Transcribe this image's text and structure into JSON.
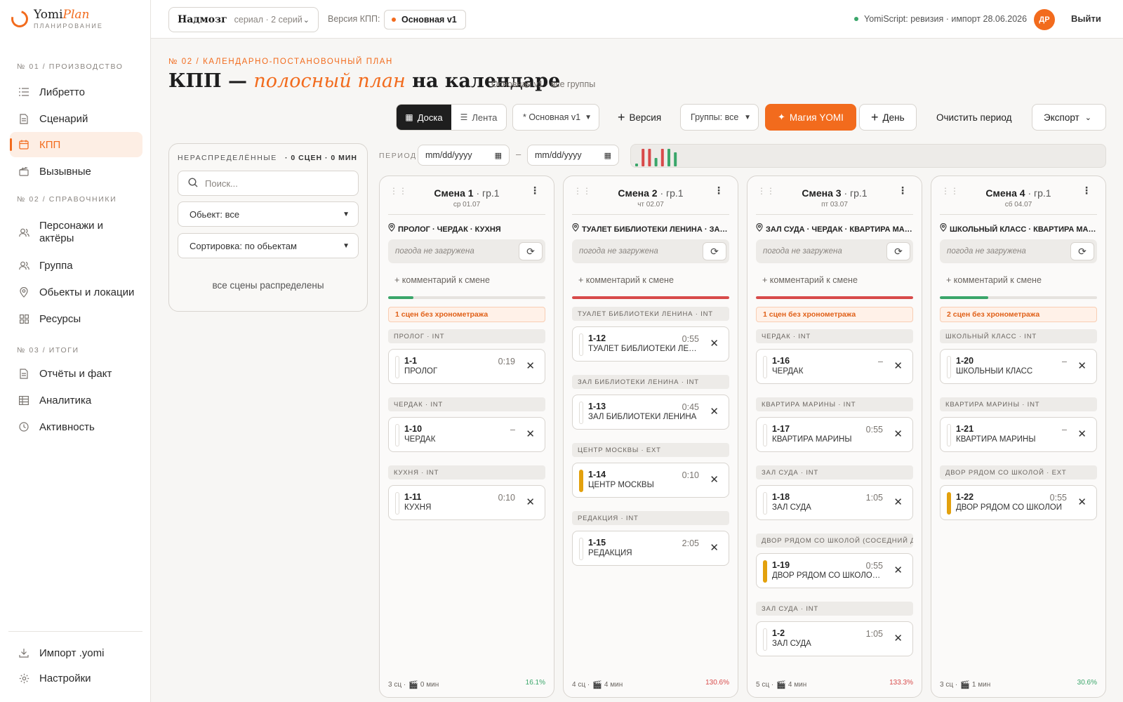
{
  "brand": {
    "name": "Yomi",
    "name_accent": "Plan",
    "sub": "ПЛАНИРОВАНИЕ",
    "accent": "#f26b1d"
  },
  "sidebar": {
    "sections": [
      {
        "title": "№ 01 / ПРОИЗВОДСТВО"
      },
      {
        "title": "№ 02 / СПРАВОЧНИКИ"
      },
      {
        "title": "№ 03 / ИТОГИ"
      }
    ],
    "items": [
      {
        "label": "Либретто",
        "icon": "list-icon"
      },
      {
        "label": "Сценарий",
        "icon": "document-icon"
      },
      {
        "label": "КПП",
        "icon": "calendar-icon",
        "active": true
      },
      {
        "label": "Вызывные",
        "icon": "clapper-icon"
      },
      {
        "label": "Персонажи и актёры",
        "icon": "people-icon"
      },
      {
        "label": "Группа",
        "icon": "group-icon"
      },
      {
        "label": "Обьекты и локации",
        "icon": "pin-icon"
      },
      {
        "label": "Ресурсы",
        "icon": "grid-icon"
      },
      {
        "label": "Отчёты и факт",
        "icon": "report-icon"
      },
      {
        "label": "Аналитика",
        "icon": "table-icon"
      },
      {
        "label": "Активность",
        "icon": "clock-icon"
      }
    ],
    "bottom": [
      {
        "label": "Импорт .yomi",
        "icon": "download-icon"
      },
      {
        "label": "Настройки",
        "icon": "gear-icon"
      }
    ]
  },
  "header": {
    "project_name": "Надмозг",
    "project_meta": "сериал · 2 серий",
    "version_label": "Версия КПП:",
    "version_value": "Основная v1",
    "status_text": "YomiScript: ревизия · импорт 28.06.2026",
    "avatar": "ДР",
    "logout": "Выйти"
  },
  "page": {
    "eyebrow": "№ 02 / КАЛЕНДАРНО-ПОСТАНОВОЧНЫЙ ПЛАН",
    "title_a": "КПП — ",
    "title_b": "полосный план",
    "title_c": " на календаре",
    "subtitle": "Основная v1 · все группы"
  },
  "toolbar": {
    "view_board": "Доска",
    "view_feed": "Лента",
    "version_select": "* Основная v1",
    "add_version": "Версия",
    "groups_select": "Группы: все",
    "magic": "Магия YOMI",
    "add_day": "День",
    "clear_period": "Очистить период",
    "export": "Экспорт"
  },
  "unassigned": {
    "title": "НЕРАСПРЕДЕЛЁННЫЕ",
    "count": "· 0 СЦЕН · 0 МИН",
    "search_placeholder": "Поиск...",
    "object_filter": "Обьект: все",
    "sort": "Сортировка: по обьектам",
    "empty": "все сцены распределены"
  },
  "period": {
    "label": "ПЕРИОД",
    "from_placeholder": "mm/dd/yyyy",
    "to_placeholder": "mm/dd/yyyy",
    "dash": "–",
    "bars": [
      {
        "value": 0.15,
        "color": "#3aa66a"
      },
      {
        "value": 0.95,
        "color": "#d84a4a"
      },
      {
        "value": 0.95,
        "color": "#d84a4a"
      },
      {
        "value": 0.45,
        "color": "#3aa66a"
      },
      {
        "value": 0.95,
        "color": "#d84a4a"
      },
      {
        "value": 0.95,
        "color": "#3aa66a"
      },
      {
        "value": 0.75,
        "color": "#3aa66a"
      }
    ]
  },
  "shifts": [
    {
      "title": "Смена 1",
      "group": " · гр.1",
      "date": "ср 01.07",
      "locations": "ПРОЛОГ · ЧЕРДАК · КУХНЯ",
      "weather": "погода не загружена",
      "comment": "+ комментарий к смене",
      "progress": 0.161,
      "progress_color": "#3aa66a",
      "warning": "1 сцен без хронометража",
      "blocks": [
        {
          "label": "ПРОЛОГ · INT",
          "scenes": [
            {
              "id": "1-1",
              "name": "ПРОЛОГ",
              "dur": "0:19",
              "mark": ""
            }
          ]
        },
        {
          "label": "ЧЕРДАК · INT",
          "scenes": [
            {
              "id": "1-10",
              "name": "ЧЕРДАК",
              "dur": "–",
              "mark": ""
            }
          ]
        },
        {
          "label": "КУХНЯ · INT",
          "scenes": [
            {
              "id": "1-11",
              "name": "КУХНЯ",
              "dur": "0:10",
              "mark": ""
            }
          ]
        }
      ],
      "foot_scenes": "3 сц ·",
      "foot_min": "0 мин",
      "pct": "16.1%",
      "pct_color": "#3aa66a"
    },
    {
      "title": "Смена 2",
      "group": " · гр.1",
      "date": "чт 02.07",
      "locations": "ТУАЛЕТ БИБЛИОТЕКИ ЛЕНИНА · ЗАЛ БИБЛИОТЕКИ ЛЕНИНА · ЦЕНТР МОСКВЫ · РЕДАКЦИЯ",
      "weather": "погода не загружена",
      "comment": "+ комментарий к смене",
      "progress": 1.0,
      "progress_color": "#d84a4a",
      "warning": "",
      "blocks": [
        {
          "label": "ТУАЛЕТ БИБЛИОТЕКИ ЛЕНИНА · INT",
          "scenes": [
            {
              "id": "1-12",
              "name": "ТУАЛЕТ БИБЛИОТЕКИ ЛЕНИНА",
              "dur": "0:55",
              "mark": ""
            }
          ]
        },
        {
          "label": "ЗАЛ БИБЛИОТЕКИ ЛЕНИНА · INT",
          "scenes": [
            {
              "id": "1-13",
              "name": "ЗАЛ БИБЛИОТЕКИ ЛЕНИНА",
              "dur": "0:45",
              "mark": ""
            }
          ]
        },
        {
          "label": "ЦЕНТР МОСКВЫ · EXT",
          "scenes": [
            {
              "id": "1-14",
              "name": "ЦЕНТР МОСКВЫ",
              "dur": "0:10",
              "mark": "amber"
            }
          ]
        },
        {
          "label": "РЕДАКЦИЯ · INT",
          "scenes": [
            {
              "id": "1-15",
              "name": "РЕДАКЦИЯ",
              "dur": "2:05",
              "mark": ""
            }
          ]
        }
      ],
      "foot_scenes": "4 сц ·",
      "foot_min": "4 мин",
      "pct": "130.6%",
      "pct_color": "#d84a4a"
    },
    {
      "title": "Смена 3",
      "group": " · гр.1",
      "date": "пт 03.07",
      "locations": "ЗАЛ СУДА · ЧЕРДАК · КВАРТИРА МАРИНЫ · ДВОР РЯДОМ СО ШКОЛОЙ",
      "weather": "погода не загружена",
      "comment": "+ комментарий к смене",
      "progress": 1.0,
      "progress_color": "#d84a4a",
      "warning": "1 сцен без хронометража",
      "blocks": [
        {
          "label": "ЧЕРДАК · INT",
          "scenes": [
            {
              "id": "1-16",
              "name": "ЧЕРДАК",
              "dur": "–",
              "mark": ""
            }
          ]
        },
        {
          "label": "КВАРТИРА МАРИНЫ · INT",
          "scenes": [
            {
              "id": "1-17",
              "name": "КВАРТИРА МАРИНЫ",
              "dur": "0:55",
              "mark": ""
            }
          ]
        },
        {
          "label": "ЗАЛ СУДА · INT",
          "scenes": [
            {
              "id": "1-18",
              "name": "ЗАЛ СУДА",
              "dur": "1:05",
              "mark": ""
            }
          ]
        },
        {
          "label": "ДВОР РЯДОМ СО ШКОЛОЙ (СОСЕДНИЙ ДВОР) · EXT",
          "scenes": [
            {
              "id": "1-19",
              "name": "ДВОР РЯДОМ СО ШКОЛОЙ (СОСЕДНИЙ ДВОР)",
              "dur": "0:55",
              "mark": "amber"
            }
          ]
        },
        {
          "label": "ЗАЛ СУДА · INT",
          "scenes": [
            {
              "id": "1-2",
              "name": "ЗАЛ СУДА",
              "dur": "1:05",
              "mark": ""
            }
          ]
        }
      ],
      "foot_scenes": "5 сц ·",
      "foot_min": "4 мин",
      "pct": "133.3%",
      "pct_color": "#d84a4a"
    },
    {
      "title": "Смена 4",
      "group": " · гр.1",
      "date": "сб 04.07",
      "locations": "ШКОЛЬНЫЙ КЛАСС · КВАРТИРА МАРИНЫ · ДВОР РЯДОМ СО ШКОЛОЙ",
      "weather": "погода не загружена",
      "comment": "+ комментарий к смене",
      "progress": 0.306,
      "progress_color": "#3aa66a",
      "warning": "2 сцен без хронометража",
      "blocks": [
        {
          "label": "ШКОЛЬНЫЙ КЛАСС · INT",
          "scenes": [
            {
              "id": "1-20",
              "name": "ШКОЛЬНЫЙ КЛАСС",
              "dur": "–",
              "mark": ""
            }
          ]
        },
        {
          "label": "КВАРТИРА МАРИНЫ · INT",
          "scenes": [
            {
              "id": "1-21",
              "name": "КВАРТИРА МАРИНЫ",
              "dur": "–",
              "mark": ""
            }
          ]
        },
        {
          "label": "ДВОР РЯДОМ СО ШКОЛОЙ · EXT",
          "scenes": [
            {
              "id": "1-22",
              "name": "ДВОР РЯДОМ СО ШКОЛОЙ",
              "dur": "0:55",
              "mark": "amber"
            }
          ]
        }
      ],
      "foot_scenes": "3 сц ·",
      "foot_min": "1 мин",
      "pct": "30.6%",
      "pct_color": "#3aa66a"
    }
  ]
}
